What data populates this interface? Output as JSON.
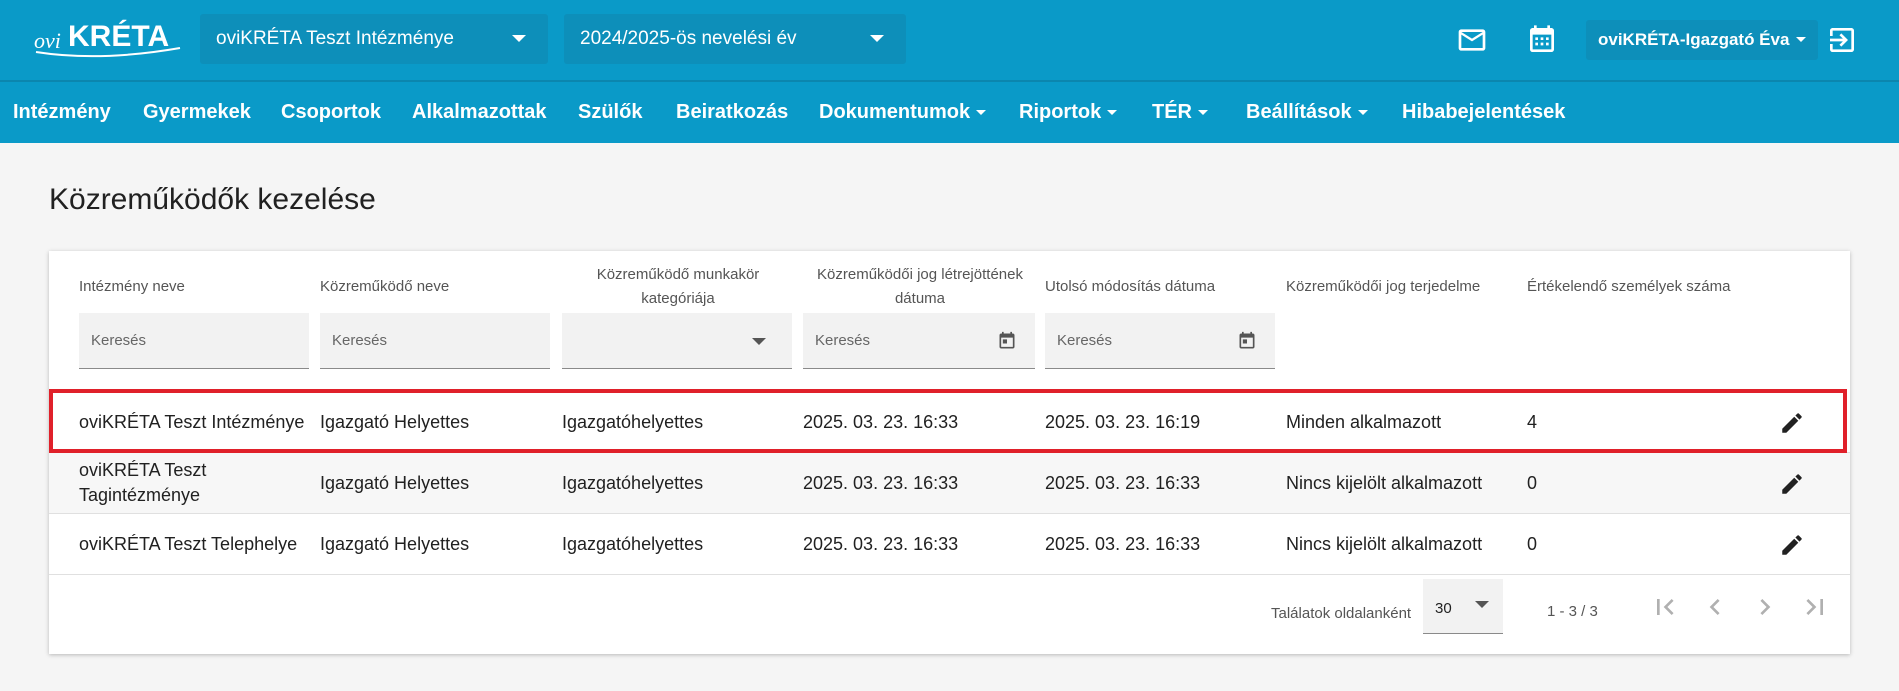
{
  "header": {
    "logo_text": "oviKRÉTA",
    "institution_select": "oviKRÉTA Teszt Intézménye",
    "year_select": "2024/2025-ös nevelési év",
    "user_name": "oviKRÉTA-Igazgató Éva",
    "icons": [
      "mail-icon",
      "calendar-icon",
      "logout-icon"
    ],
    "bg_color": "#0a9ac8"
  },
  "nav": {
    "items": [
      {
        "label": "Intézmény",
        "dropdown": false
      },
      {
        "label": "Gyermekek",
        "dropdown": false
      },
      {
        "label": "Csoportok",
        "dropdown": false
      },
      {
        "label": "Alkalmazottak",
        "dropdown": false
      },
      {
        "label": "Szülők",
        "dropdown": false
      },
      {
        "label": "Beiratkozás",
        "dropdown": false
      },
      {
        "label": "Dokumentumok",
        "dropdown": true
      },
      {
        "label": "Riportok",
        "dropdown": true
      },
      {
        "label": "TÉR",
        "dropdown": true
      },
      {
        "label": "Beállítások",
        "dropdown": true
      },
      {
        "label": "Hibabejelentések",
        "dropdown": false
      }
    ]
  },
  "page": {
    "title": "Közreműködők kezelése"
  },
  "table": {
    "columns": [
      "Intézmény neve",
      "Közreműködő neve",
      "Közreműködő munkakör kategóriája",
      "Közreműködői jog létrejöttének dátuma",
      "Utolsó módosítás dátuma",
      "Közreműködői jog terjedelme",
      "Értékelendő személyek száma"
    ],
    "filters": {
      "institution": "Keresés",
      "name": "Keresés",
      "category": "",
      "created": "Keresés",
      "modified": "Keresés"
    },
    "rows": [
      {
        "institution": "oviKRÉTA Teszt Intézménye",
        "name": "Igazgató Helyettes",
        "category": "Igazgatóhelyettes",
        "created": "2025. 03. 23. 16:33",
        "modified": "2025. 03. 23. 16:19",
        "scope": "Minden alkalmazott",
        "count": "4",
        "highlighted": true
      },
      {
        "institution": "oviKRÉTA Teszt Tagintézménye",
        "name": "Igazgató Helyettes",
        "category": "Igazgatóhelyettes",
        "created": "2025. 03. 23. 16:33",
        "modified": "2025. 03. 23. 16:33",
        "scope": "Nincs kijelölt alkalmazott",
        "count": "0",
        "highlighted": false
      },
      {
        "institution": "oviKRÉTA Teszt Telephelye",
        "name": "Igazgató Helyettes",
        "category": "Igazgatóhelyettes",
        "created": "2025. 03. 23. 16:33",
        "modified": "2025. 03. 23. 16:33",
        "scope": "Nincs kijelölt alkalmazott",
        "count": "0",
        "highlighted": false
      }
    ],
    "highlight_color": "#e0202a"
  },
  "pagination": {
    "per_page_label": "Találatok oldalanként",
    "per_page_value": "30",
    "range": "1 - 3 / 3"
  }
}
